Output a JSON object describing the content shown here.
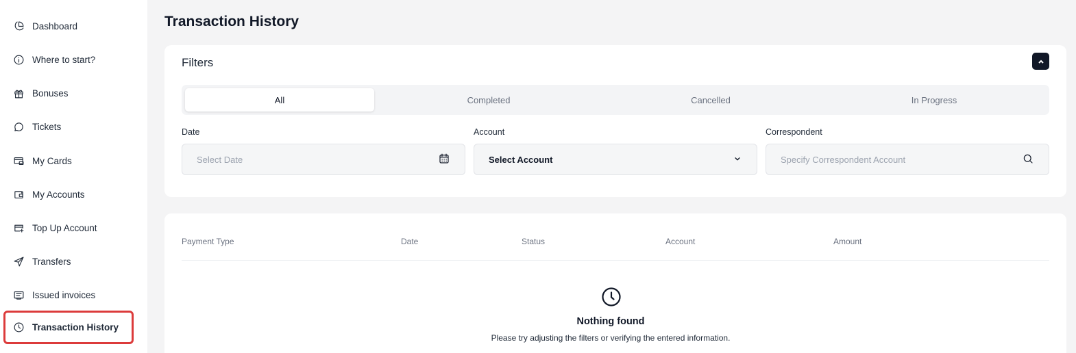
{
  "sidebar": {
    "items": [
      {
        "label": "Dashboard",
        "icon": "pie-chart-icon"
      },
      {
        "label": "Where to start?",
        "icon": "info-icon"
      },
      {
        "label": "Bonuses",
        "icon": "gift-icon"
      },
      {
        "label": "Tickets",
        "icon": "chat-bubble-icon"
      },
      {
        "label": "My Cards",
        "icon": "card-icon"
      },
      {
        "label": "My Accounts",
        "icon": "wallet-icon"
      },
      {
        "label": "Top Up Account",
        "icon": "card-plus-icon"
      },
      {
        "label": "Transfers",
        "icon": "send-icon"
      },
      {
        "label": "Issued invoices",
        "icon": "invoice-icon"
      },
      {
        "label": "Transaction History",
        "icon": "clock-icon",
        "active": true
      }
    ]
  },
  "page": {
    "title": "Transaction History"
  },
  "filters": {
    "title": "Filters",
    "tabs": [
      "All",
      "Completed",
      "Cancelled",
      "In Progress"
    ],
    "active_tab": "All",
    "date": {
      "label": "Date",
      "placeholder": "Select Date"
    },
    "account": {
      "label": "Account",
      "value": "Select Account"
    },
    "correspondent": {
      "label": "Correspondent",
      "placeholder": "Specify Correspondent Account"
    }
  },
  "table": {
    "columns": [
      "Payment Type",
      "Date",
      "Status",
      "Account",
      "Amount"
    ],
    "empty": {
      "title": "Nothing found",
      "text": "Please try adjusting the filters or verifying the entered information."
    }
  },
  "colors": {
    "active_outline": "#dc3b3b",
    "primary_dark": "#111827",
    "background": "#f4f4f5"
  }
}
